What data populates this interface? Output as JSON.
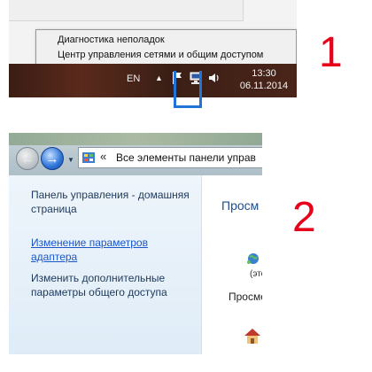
{
  "step_labels": {
    "one": "1",
    "two": "2"
  },
  "panel1": {
    "context_menu": {
      "troubleshoot": "Диагностика неполадок",
      "network_center": "Центр управления сетями и общим доступом"
    },
    "taskbar": {
      "language": "EN",
      "time": "13:30",
      "date": "06.11.2014"
    }
  },
  "panel2": {
    "address": "Все элементы панели управ",
    "address_separator": "«",
    "sidebar": {
      "home": "Панель управления - домашняя страница",
      "change_adapter": "Изменение параметров адаптера",
      "sharing": "Изменить дополнительные параметры общего доступа"
    },
    "main": {
      "title": "Просм",
      "small": "(это",
      "view": "Просмо"
    }
  },
  "colors": {
    "accent_red": "#e8001b",
    "highlight_blue": "#1f74d6",
    "link_blue": "#1a56c9"
  }
}
